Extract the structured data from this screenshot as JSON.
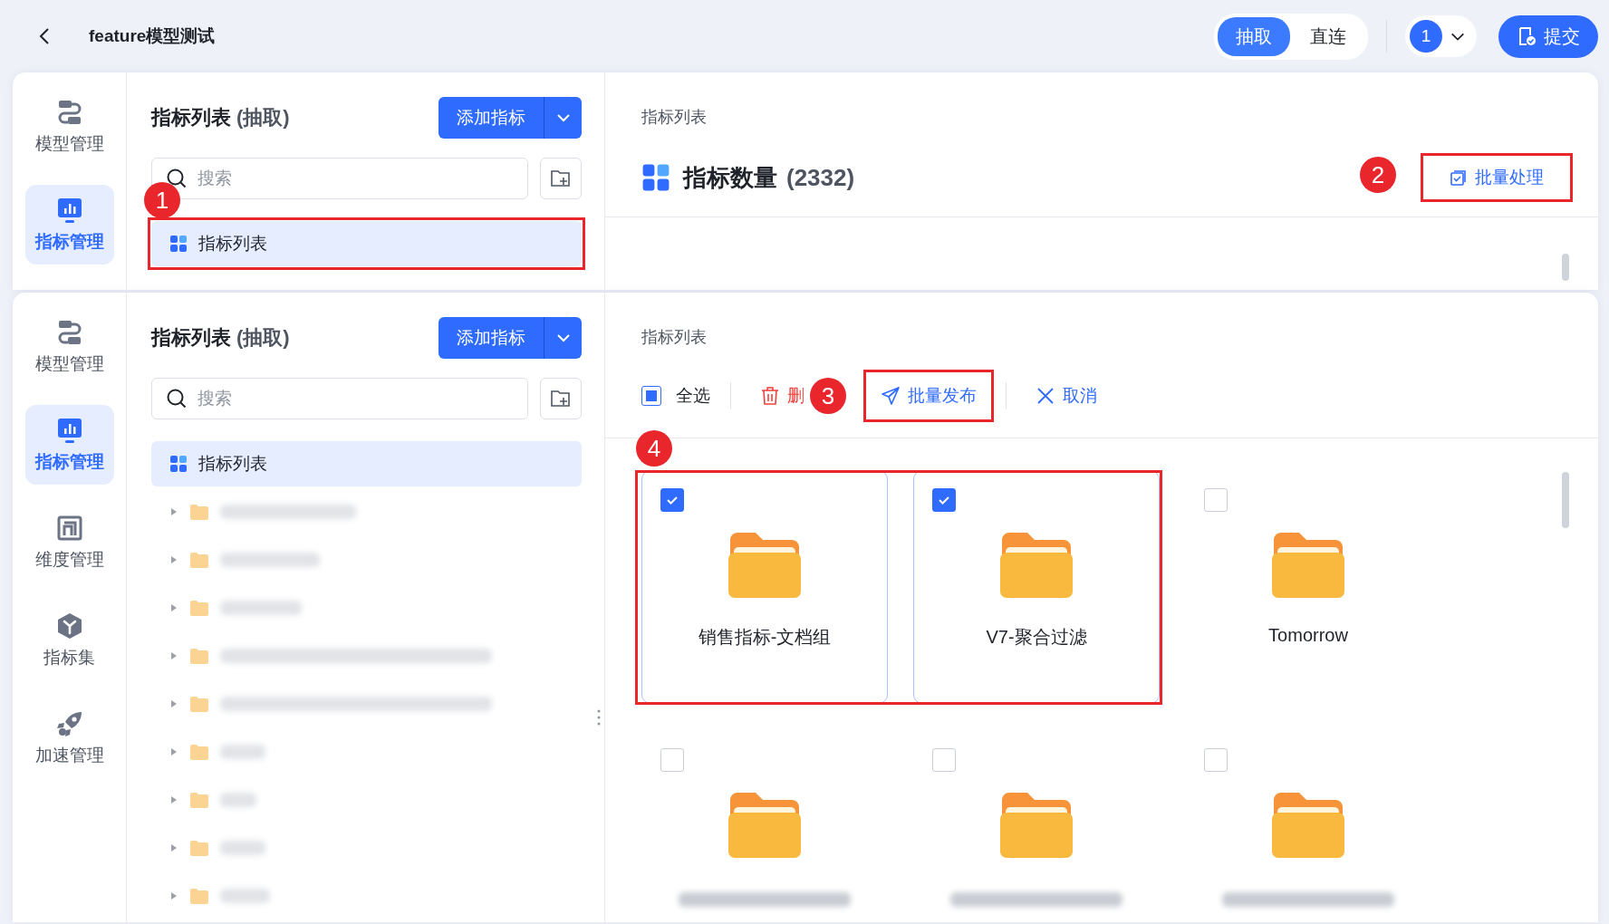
{
  "header": {
    "title": "feature模型测试",
    "modes": [
      {
        "label": "抽取",
        "selected": true
      },
      {
        "label": "直连",
        "selected": false
      }
    ],
    "version": "1",
    "submit": "提交"
  },
  "top_panel": {
    "nav": [
      {
        "label": "模型管理",
        "selected": false
      },
      {
        "label": "指标管理",
        "selected": true
      }
    ],
    "tree": {
      "title": "指标列表",
      "mode": "(抽取)",
      "add_button": "添加指标",
      "search_placeholder": "搜索",
      "items": [
        {
          "kind": "root",
          "label": "指标列表",
          "selected": true,
          "callout": "1"
        }
      ]
    },
    "main": {
      "breadcrumb": "指标列表",
      "count_title": "指标数量",
      "count": "(2332)",
      "batch_button": "批量处理",
      "batch_callout": "2"
    }
  },
  "bottom_panel": {
    "nav": [
      {
        "label": "模型管理",
        "selected": false
      },
      {
        "label": "指标管理",
        "selected": true
      },
      {
        "label": "维度管理",
        "selected": false
      },
      {
        "label": "指标集",
        "selected": false
      },
      {
        "label": "加速管理",
        "selected": false
      }
    ],
    "tree": {
      "title": "指标列表",
      "mode": "(抽取)",
      "add_button": "添加指标",
      "search_placeholder": "搜索",
      "items": [
        {
          "kind": "root",
          "label": "指标列表",
          "selected": true
        },
        {
          "kind": "redacted",
          "selected": false
        },
        {
          "kind": "redacted",
          "selected": false
        },
        {
          "kind": "redacted",
          "selected": false
        },
        {
          "kind": "redacted",
          "selected": false
        },
        {
          "kind": "redacted",
          "selected": false
        },
        {
          "kind": "redacted",
          "selected": false
        },
        {
          "kind": "redacted",
          "selected": false
        },
        {
          "kind": "redacted",
          "selected": false
        },
        {
          "kind": "redacted",
          "selected": false
        }
      ]
    },
    "main": {
      "breadcrumb": "指标列表",
      "select_all": {
        "label": "全选",
        "indeterminate": true
      },
      "delete_button": "删",
      "publish_button": "批量发布",
      "publish_callout": "3",
      "cancel_button": "取消",
      "cards_callout": "4",
      "cards": [
        {
          "kind": "folder",
          "name": "销售指标-文档组",
          "checked": true
        },
        {
          "kind": "folder",
          "name": "V7-聚合过滤",
          "checked": true
        },
        {
          "kind": "folder",
          "name": "Tomorrow",
          "checked": false
        },
        {
          "kind": "redacted",
          "checked": false
        },
        {
          "kind": "redacted",
          "checked": false
        },
        {
          "kind": "redacted",
          "checked": false
        }
      ]
    }
  }
}
